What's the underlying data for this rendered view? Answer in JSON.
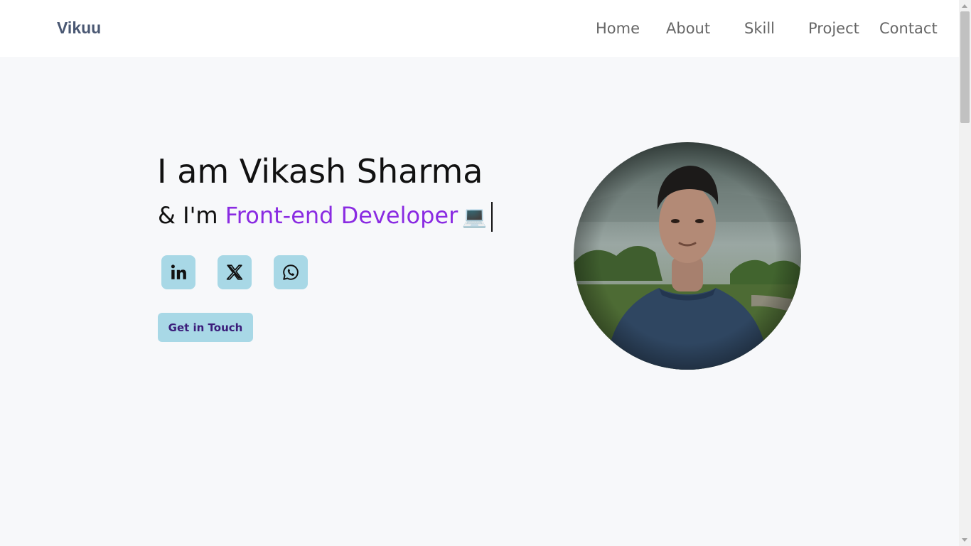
{
  "reading_progress": 0.2,
  "navbar": {
    "brand": "Vikuu",
    "links": [
      {
        "label": "Home"
      },
      {
        "label": "About"
      },
      {
        "label": "Skill"
      },
      {
        "label": "Project"
      },
      {
        "label": "Contact"
      }
    ]
  },
  "hero": {
    "title": "I am Vikash Sharma",
    "subtitle_prefix": "& I'm ",
    "role": "Front-end Developer",
    "emoji": "💻",
    "cta_label": "Get in Touch"
  },
  "socials": [
    {
      "name": "linkedin-icon"
    },
    {
      "name": "x-icon"
    },
    {
      "name": "whatsapp-icon"
    }
  ],
  "colors": {
    "accent": "#8a2be2",
    "button_bg": "#a8d8e6",
    "button_text": "#3b1d7a",
    "brand": "#4a5873",
    "progress": "#1a73e8"
  }
}
